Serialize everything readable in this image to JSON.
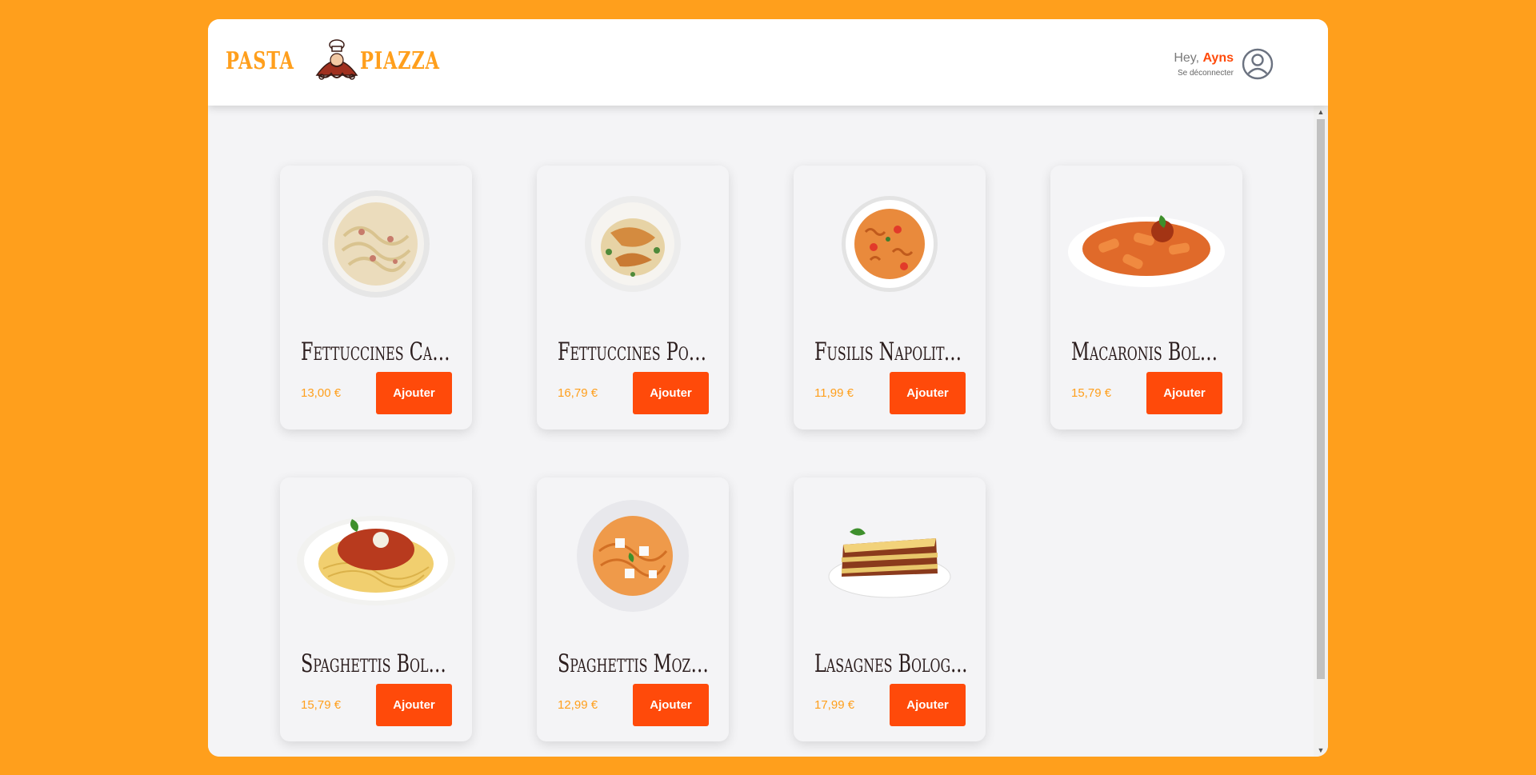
{
  "brand": {
    "word1": "Pasta",
    "word2": "Piazza",
    "accent": "#ff9f1c"
  },
  "user": {
    "greeting": "Hey, ",
    "name": "Ayns",
    "logout": "Se déconnecter"
  },
  "colors": {
    "background": "#ff9f1c",
    "button": "#ff4a0a",
    "price": "#ff9f1c"
  },
  "products": [
    {
      "name": "Fettuccines Carb...",
      "price": "13,00 €",
      "button": "Ajouter",
      "image": "fettuccine-carbonara-image"
    },
    {
      "name": "Fettuccines Poulet",
      "price": "16,79 €",
      "button": "Ajouter",
      "image": "fettuccine-chicken-image"
    },
    {
      "name": "Fusilis Napolitai...",
      "price": "11,99 €",
      "button": "Ajouter",
      "image": "fusilli-napoletana-image"
    },
    {
      "name": "Macaronis Bolo...",
      "price": "15,79 €",
      "button": "Ajouter",
      "image": "macaroni-bolognese-image"
    },
    {
      "name": "Spaghettis Bolog...",
      "price": "15,79 €",
      "button": "Ajouter",
      "image": "spaghetti-bolognese-image"
    },
    {
      "name": "Spaghettis Mozza...",
      "price": "12,99 €",
      "button": "Ajouter",
      "image": "spaghetti-mozzarella-image"
    },
    {
      "name": "Lasagnes Bolog...",
      "price": "17,99 €",
      "button": "Ajouter",
      "image": "lasagna-bolognese-image"
    }
  ]
}
